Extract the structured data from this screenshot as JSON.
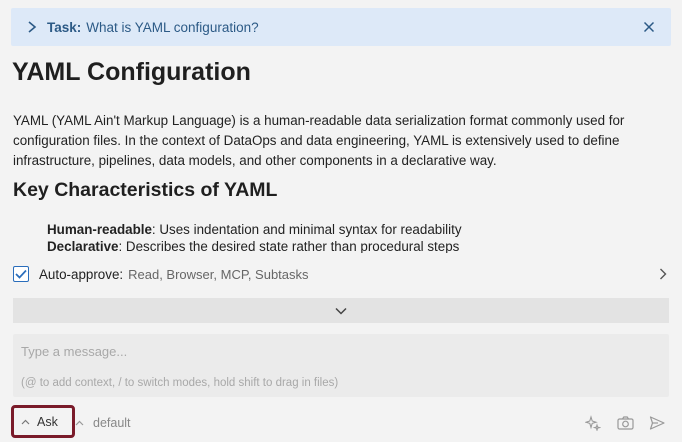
{
  "task": {
    "label": "Task:",
    "text": "What is YAML configuration?"
  },
  "content": {
    "title": "YAML Configuration",
    "paragraph": "YAML (YAML Ain't Markup Language) is a human-readable data serialization format commonly used for configuration files. In the context of DataOps and data engineering, YAML is extensively used to define infrastructure, pipelines, data models, and other components in a declarative way.",
    "section_heading": "Key Characteristics of YAML",
    "bullets": [
      {
        "term": "Human-readable",
        "desc": ": Uses indentation and minimal syntax for readability"
      },
      {
        "term": "Declarative",
        "desc": ": Describes the desired state rather than procedural steps"
      }
    ]
  },
  "auto_approve": {
    "checked": true,
    "label": "Auto-approve:",
    "items": "Read, Browser, MCP, Subtasks"
  },
  "composer": {
    "placeholder": "Type a message...",
    "hint": "(@ to add context, / to switch modes, hold shift to drag in files)"
  },
  "footer": {
    "mode": "Ask",
    "profile": "default"
  },
  "colors": {
    "task_bg": "#dde9f8",
    "task_text": "#2c5a86",
    "checkbox_accent": "#2a6dbb",
    "highlight_border": "#7a1b2a"
  },
  "icons": {
    "task_expand": "chevron-right-icon",
    "task_close": "close-icon",
    "auto_approve_expand": "chevron-right-icon",
    "expand_bar": "chevron-down-icon",
    "mode_caret": "chevron-up-icon",
    "enhance": "sparkle-icon",
    "image": "camera-icon",
    "send": "send-icon"
  }
}
